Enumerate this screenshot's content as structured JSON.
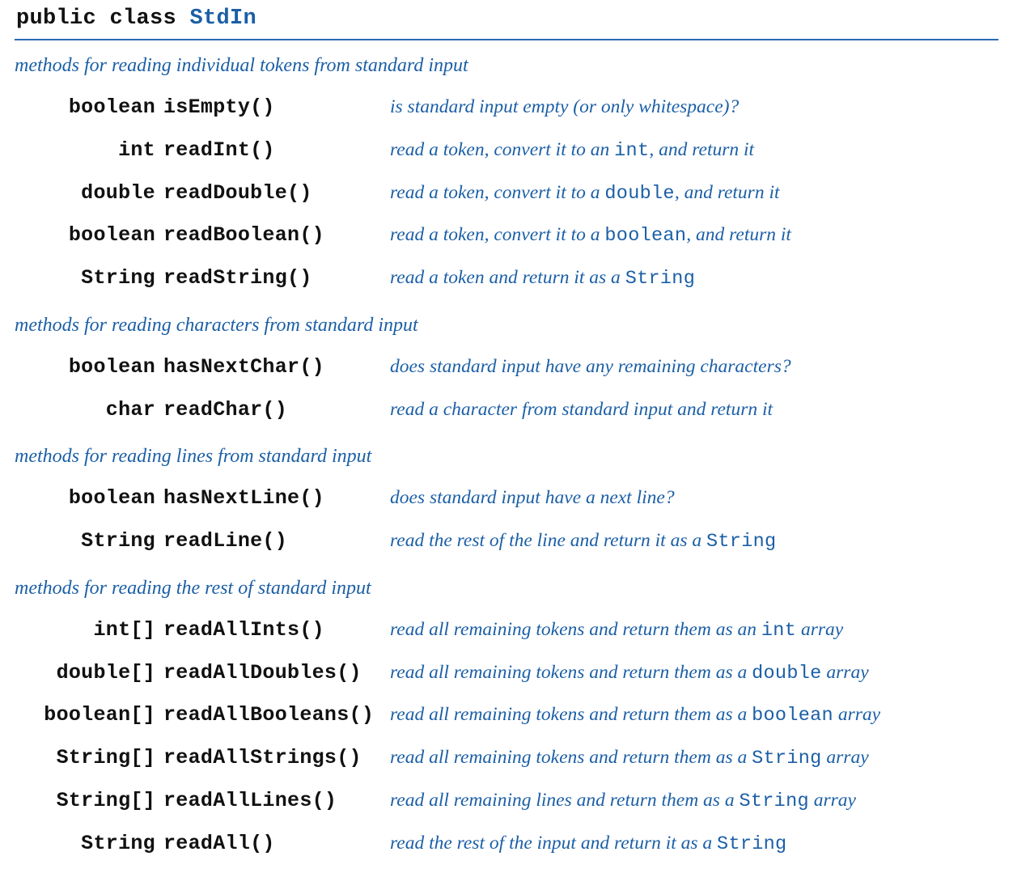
{
  "header": {
    "prefix": "public class ",
    "className": "StdIn"
  },
  "sections": [
    {
      "title": "methods for reading individual tokens from standard input",
      "methods": [
        {
          "returnType": "boolean",
          "name": "isEmpty()",
          "description": [
            {
              "t": "is standard input empty (or only whitespace)?",
              "code": false
            }
          ]
        },
        {
          "returnType": "int",
          "name": "readInt()",
          "description": [
            {
              "t": "read a token, convert it to an ",
              "code": false
            },
            {
              "t": "int",
              "code": true
            },
            {
              "t": ", and return it",
              "code": false
            }
          ]
        },
        {
          "returnType": "double",
          "name": "readDouble()",
          "description": [
            {
              "t": "read a token, convert it to a ",
              "code": false
            },
            {
              "t": "double",
              "code": true
            },
            {
              "t": ", and return it",
              "code": false
            }
          ]
        },
        {
          "returnType": "boolean",
          "name": "readBoolean()",
          "description": [
            {
              "t": "read a token, convert it to a ",
              "code": false
            },
            {
              "t": "boolean",
              "code": true
            },
            {
              "t": ", and return it",
              "code": false
            }
          ]
        },
        {
          "returnType": "String",
          "name": "readString()",
          "description": [
            {
              "t": "read a token and return it as a ",
              "code": false
            },
            {
              "t": "String",
              "code": true
            }
          ]
        }
      ]
    },
    {
      "title": "methods for reading characters from standard input",
      "methods": [
        {
          "returnType": "boolean",
          "name": "hasNextChar()",
          "description": [
            {
              "t": "does standard input have any remaining characters?",
              "code": false
            }
          ]
        },
        {
          "returnType": "char",
          "name": "readChar()",
          "description": [
            {
              "t": "read a character from standard input and return it",
              "code": false
            }
          ]
        }
      ]
    },
    {
      "title": "methods for reading lines from standard input",
      "methods": [
        {
          "returnType": "boolean",
          "name": "hasNextLine()",
          "description": [
            {
              "t": "does standard input have a next line?",
              "code": false
            }
          ]
        },
        {
          "returnType": "String",
          "name": "readLine()",
          "description": [
            {
              "t": "read the rest of the line and return it as a ",
              "code": false
            },
            {
              "t": "String",
              "code": true
            }
          ]
        }
      ]
    },
    {
      "title": "methods for reading the rest of standard input",
      "methods": [
        {
          "returnType": "int[]",
          "name": "readAllInts()",
          "description": [
            {
              "t": "read all remaining tokens and return them as an ",
              "code": false
            },
            {
              "t": "int",
              "code": true
            },
            {
              "t": " array",
              "code": false
            }
          ]
        },
        {
          "returnType": "double[]",
          "name": "readAllDoubles()",
          "description": [
            {
              "t": "read all remaining tokens and return them as a ",
              "code": false
            },
            {
              "t": "double",
              "code": true
            },
            {
              "t": " array",
              "code": false
            }
          ]
        },
        {
          "returnType": "boolean[]",
          "name": "readAllBooleans()",
          "description": [
            {
              "t": "read all remaining tokens and return them as a ",
              "code": false
            },
            {
              "t": "boolean",
              "code": true
            },
            {
              "t": " array",
              "code": false
            }
          ]
        },
        {
          "returnType": "String[]",
          "name": "readAllStrings()",
          "description": [
            {
              "t": "read all remaining tokens and return them as a ",
              "code": false
            },
            {
              "t": "String",
              "code": true
            },
            {
              "t": " array",
              "code": false
            }
          ]
        },
        {
          "returnType": "String[]",
          "name": "readAllLines()",
          "description": [
            {
              "t": "read all remaining lines and return them as a ",
              "code": false
            },
            {
              "t": "String",
              "code": true
            },
            {
              "t": " array",
              "code": false
            }
          ]
        },
        {
          "returnType": "String",
          "name": "readAll()",
          "description": [
            {
              "t": "read the rest of the input and return it as a ",
              "code": false
            },
            {
              "t": "String",
              "code": true
            }
          ]
        }
      ]
    }
  ]
}
